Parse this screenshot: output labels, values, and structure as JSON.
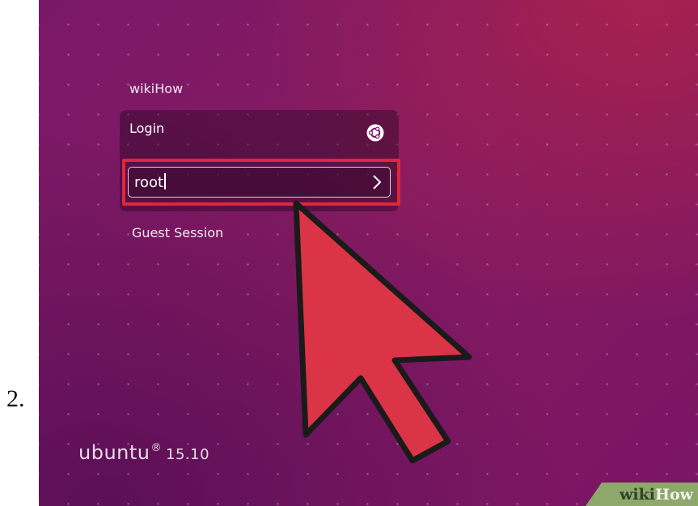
{
  "step": {
    "number": "2."
  },
  "greeter": {
    "user_name": "wikiHow",
    "login_label": "Login",
    "session_icon": "ubuntu-session-icon",
    "password_value": "root",
    "submit_icon": "chevron-right-icon",
    "guest_session": "Guest Session"
  },
  "branding": {
    "name": "ubuntu",
    "registered": "®",
    "version": "15.10"
  },
  "watermark": {
    "wiki": "wiki",
    "how": "How"
  },
  "colors": {
    "background": "#7f1965",
    "highlight_border": "#e0263c",
    "pointer_fill": "#db3446",
    "watermark_band": "#8ea76a"
  }
}
